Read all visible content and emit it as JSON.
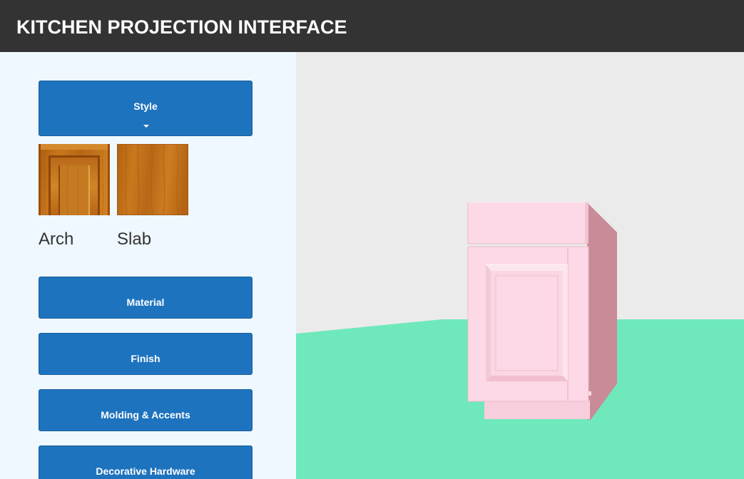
{
  "header": {
    "title": "KITCHEN PROJECTION INTERFACE"
  },
  "sidebar": {
    "style_button": {
      "label": "Style",
      "icon": "caret-down-icon"
    },
    "door_styles": [
      {
        "label": "Arch",
        "texture": "wood-grain-arch-door"
      },
      {
        "label": "Slab",
        "texture": "wood-grain-slab-door"
      }
    ],
    "buttons": [
      {
        "label": "Material"
      },
      {
        "label": "Finish"
      },
      {
        "label": "Molding & Accents"
      },
      {
        "label": "Decorative Hardware"
      }
    ]
  },
  "viewport": {
    "background_color": "#ebebeb",
    "floor_color": "#6fe8bb",
    "cabinet_color": "#fdd8e6"
  },
  "colors": {
    "header_bg": "#333333",
    "sidebar_bg": "#eef8fe",
    "button_bg": "#1e73be"
  }
}
